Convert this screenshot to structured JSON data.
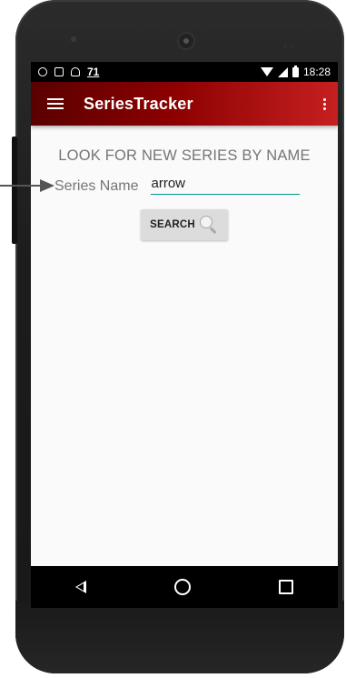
{
  "status_bar": {
    "notification_count": "71",
    "time": "18:28"
  },
  "app_bar": {
    "title": "SeriesTracker"
  },
  "search_form": {
    "heading": "LOOK FOR NEW SERIES BY NAME",
    "field_label": "Series Name",
    "field_value": "arrow",
    "button_label": "SEARCH"
  },
  "icons": {
    "menu": "hamburger-menu-icon",
    "overflow": "overflow-menu-icon",
    "search": "magnifier-icon",
    "nav_back": "back-triangle-icon",
    "nav_home": "home-circle-icon",
    "nav_recent": "recent-square-icon"
  },
  "colors": {
    "app_bar_start": "#5a0000",
    "app_bar_end": "#c62020",
    "input_underline": "#009688",
    "button_bg": "#dcdcdc"
  }
}
